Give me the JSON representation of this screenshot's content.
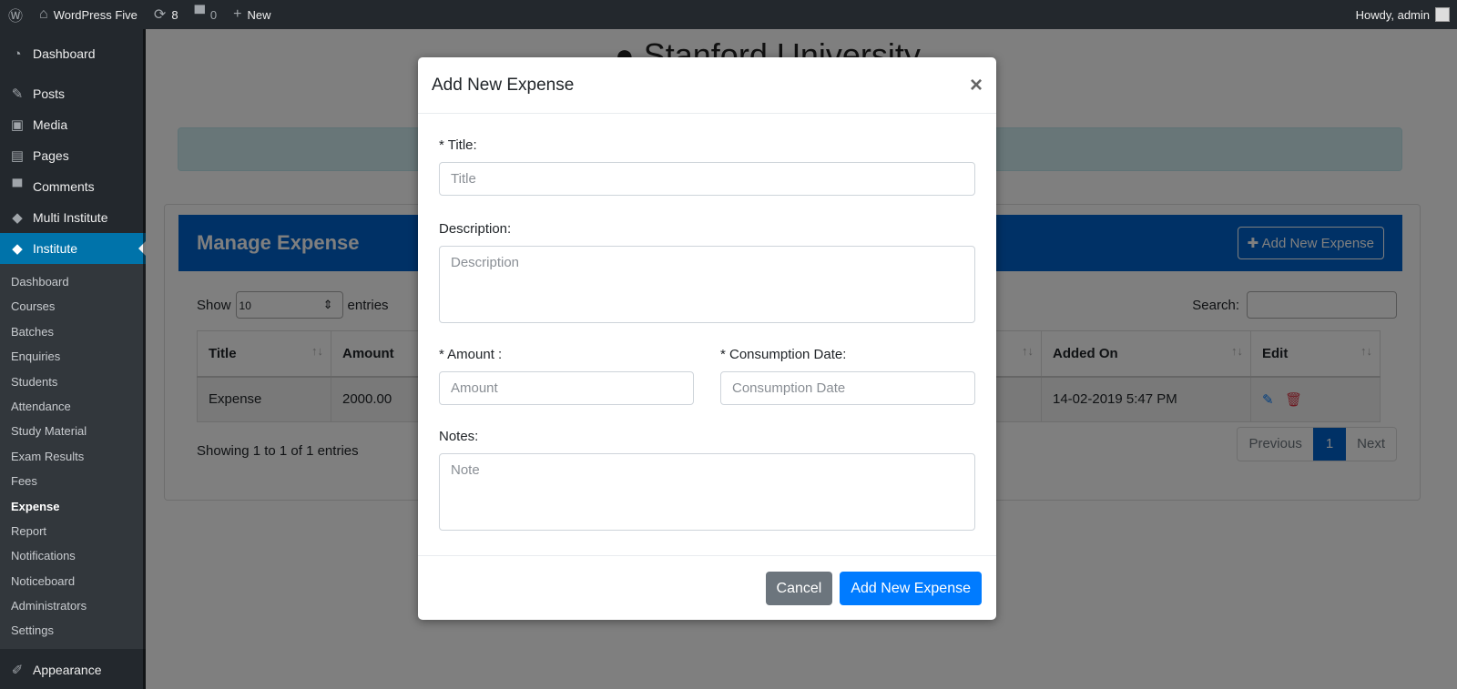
{
  "adminbar": {
    "site": "WordPress Five",
    "updates": "8",
    "comments": "0",
    "new": "New",
    "howdy": "Howdy, admin"
  },
  "sidebar": {
    "items": [
      {
        "label": "Dashboard",
        "icon": "gauge"
      },
      {
        "label": "Posts",
        "icon": "pin"
      },
      {
        "label": "Media",
        "icon": "media"
      },
      {
        "label": "Pages",
        "icon": "pages"
      },
      {
        "label": "Comments",
        "icon": "comment"
      },
      {
        "label": "Multi Institute",
        "icon": "mortarboard"
      },
      {
        "label": "Institute",
        "icon": "mortarboard"
      }
    ],
    "submenu": [
      "Dashboard",
      "Courses",
      "Batches",
      "Enquiries",
      "Students",
      "Attendance",
      "Study Material",
      "Exam Results",
      "Fees",
      "Expense",
      "Report",
      "Notifications",
      "Noticeboard",
      "Administrators",
      "Settings"
    ],
    "appearance": "Appearance"
  },
  "main": {
    "brand": "Stanford University",
    "card_title": "Manage Expense",
    "add_button": "Add New Expense",
    "show": "Show",
    "entries_value": "10",
    "entries": "entries",
    "search": "Search:",
    "columns": [
      "Title",
      "Amount",
      "Added On",
      "Edit"
    ],
    "rows": [
      {
        "title": "Expense",
        "amount": "2000.00",
        "added_on": "14-02-2019 5:47 PM"
      }
    ],
    "info": "Showing 1 to 1 of 1 entries",
    "pager": {
      "prev": "Previous",
      "page": "1",
      "next": "Next"
    }
  },
  "modal": {
    "title": "Add New Expense",
    "close": "×",
    "title_label": "* Title:",
    "title_ph": "Title",
    "desc_label": "Description:",
    "desc_ph": "Description",
    "amount_label": "* Amount :",
    "amount_ph": "Amount",
    "date_label": "* Consumption Date:",
    "date_ph": "Consumption Date",
    "notes_label": "Notes:",
    "notes_ph": "Note",
    "cancel": "Cancel",
    "submit": "Add New Expense"
  }
}
